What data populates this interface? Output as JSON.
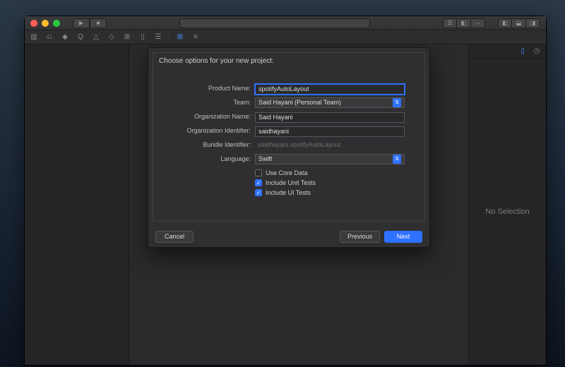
{
  "dialog": {
    "prompt": "Choose options for your new project:",
    "labels": {
      "product_name": "Product Name:",
      "team": "Team:",
      "org_name": "Organization Name:",
      "org_id": "Organization Identifier:",
      "bundle_id": "Bundle Identifier:",
      "language": "Language:"
    },
    "values": {
      "product_name": "spotifyAutoLayout",
      "team": "Said Hayani (Personal Team)",
      "org_name": "Said Hayani",
      "org_id": "saidhayani",
      "bundle_id": "saidhayani.spotifyAutoLayout",
      "language": "Swift"
    },
    "checks": {
      "core_data": "Use Core Data",
      "unit_tests": "Include Unit Tests",
      "ui_tests": "Include UI Tests"
    },
    "buttons": {
      "cancel": "Cancel",
      "previous": "Previous",
      "next": "Next"
    }
  },
  "inspector": {
    "placeholder": "No Selection"
  }
}
